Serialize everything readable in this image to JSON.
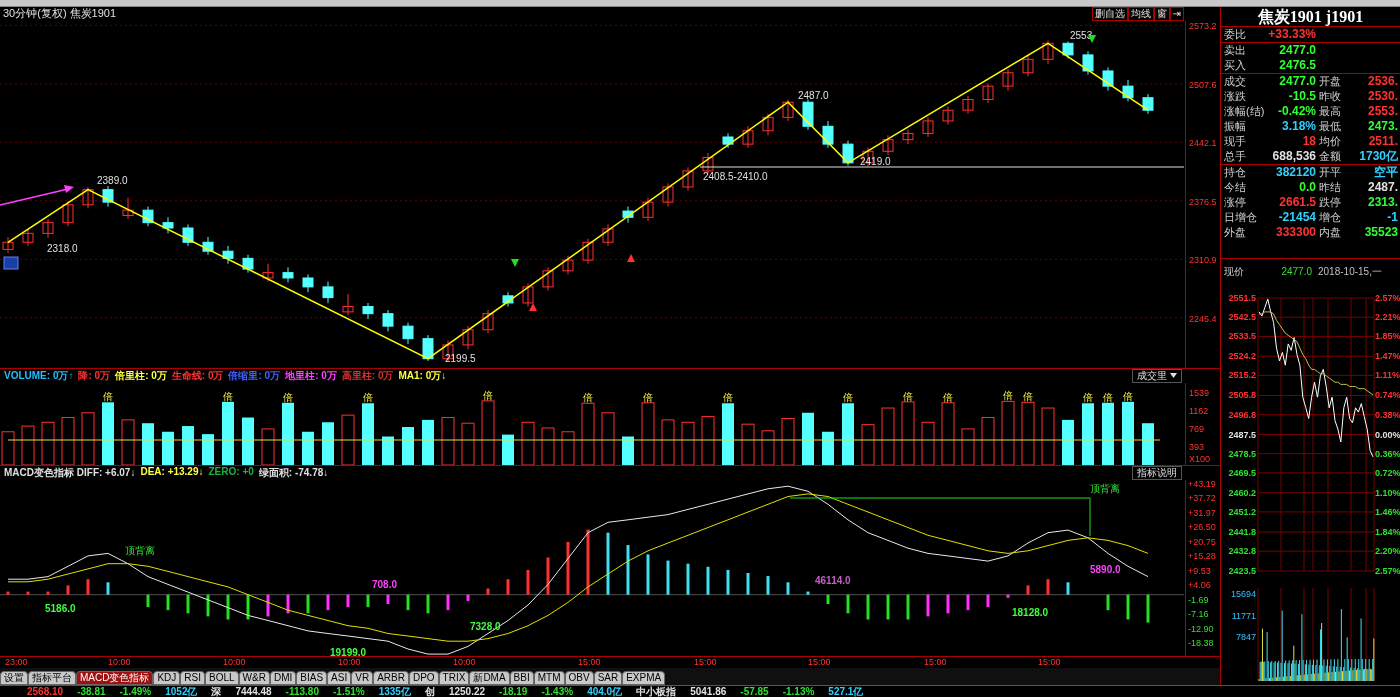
{
  "header": {
    "title": "30分钟(复权) 焦炭1901",
    "buttons": [
      "删自选",
      "均线",
      "窗",
      "⇥"
    ]
  },
  "main_chart": {
    "price_axis": [
      "2573.2",
      "2507.6",
      "2442.1",
      "2376.5",
      "2310.9",
      "2245.4"
    ],
    "chart_data": {
      "type": "candlestick",
      "grid": true,
      "ylim": [
        2189.1,
        2578
      ],
      "yticks": [
        2573.2,
        2507.6,
        2442.1,
        2376.5,
        2310.9,
        2245.4
      ],
      "ohlc": [
        [
          2322,
          2336,
          2318,
          2330
        ],
        [
          2330,
          2345,
          2326,
          2340
        ],
        [
          2340,
          2356,
          2335,
          2352
        ],
        [
          2352,
          2376,
          2348,
          2372
        ],
        [
          2372,
          2392,
          2368,
          2389
        ],
        [
          2389,
          2393,
          2370,
          2375
        ],
        [
          2360,
          2380,
          2356,
          2366
        ],
        [
          2366,
          2370,
          2348,
          2352
        ],
        [
          2352,
          2358,
          2340,
          2346
        ],
        [
          2346,
          2350,
          2326,
          2330
        ],
        [
          2330,
          2336,
          2316,
          2320
        ],
        [
          2320,
          2326,
          2306,
          2312
        ],
        [
          2312,
          2316,
          2296,
          2300
        ],
        [
          2290,
          2306,
          2286,
          2296
        ],
        [
          2296,
          2302,
          2285,
          2290
        ],
        [
          2290,
          2294,
          2274,
          2280
        ],
        [
          2280,
          2286,
          2262,
          2268
        ],
        [
          2252,
          2272,
          2248,
          2258
        ],
        [
          2258,
          2262,
          2244,
          2250
        ],
        [
          2250,
          2254,
          2230,
          2236
        ],
        [
          2236,
          2240,
          2216,
          2222
        ],
        [
          2222,
          2226,
          2197,
          2199.5
        ],
        [
          2199.5,
          2220,
          2196,
          2215
        ],
        [
          2215,
          2236,
          2210,
          2232
        ],
        [
          2232,
          2254,
          2228,
          2250
        ],
        [
          2270,
          2274,
          2258,
          2262
        ],
        [
          2262,
          2284,
          2258,
          2280
        ],
        [
          2280,
          2302,
          2276,
          2298
        ],
        [
          2298,
          2315,
          2294,
          2310
        ],
        [
          2310,
          2334,
          2306,
          2330
        ],
        [
          2330,
          2350,
          2326,
          2345
        ],
        [
          2365,
          2370,
          2352,
          2358
        ],
        [
          2358,
          2380,
          2354,
          2375
        ],
        [
          2375,
          2396,
          2370,
          2392
        ],
        [
          2392,
          2414,
          2388,
          2410
        ],
        [
          2410,
          2430,
          2406,
          2425
        ],
        [
          2448,
          2452,
          2436,
          2440
        ],
        [
          2440,
          2460,
          2436,
          2455
        ],
        [
          2455,
          2474,
          2450,
          2470
        ],
        [
          2470,
          2490,
          2466,
          2487
        ],
        [
          2487,
          2490,
          2456,
          2460
        ],
        [
          2460,
          2466,
          2436,
          2440
        ],
        [
          2440,
          2444,
          2416,
          2419
        ],
        [
          2419,
          2436,
          2415,
          2432
        ],
        [
          2432,
          2450,
          2428,
          2445
        ],
        [
          2445,
          2456,
          2440,
          2452
        ],
        [
          2452,
          2470,
          2448,
          2466
        ],
        [
          2466,
          2482,
          2462,
          2478
        ],
        [
          2478,
          2494,
          2474,
          2490
        ],
        [
          2490,
          2508,
          2486,
          2505
        ],
        [
          2505,
          2524,
          2500,
          2520
        ],
        [
          2520,
          2540,
          2516,
          2535
        ],
        [
          2535,
          2556,
          2530,
          2553
        ],
        [
          2553,
          2555,
          2536,
          2540
        ],
        [
          2540,
          2544,
          2518,
          2522
        ],
        [
          2522,
          2526,
          2500,
          2505
        ],
        [
          2505,
          2512,
          2488,
          2492
        ],
        [
          2492,
          2496,
          2474,
          2478
        ]
      ]
    },
    "pivots": [
      {
        "label": "2318.0"
      },
      {
        "label": "2389.0"
      },
      {
        "label": "2199.5"
      },
      {
        "label": "2487.0"
      },
      {
        "label": "2419.0"
      },
      {
        "label": "2553"
      }
    ],
    "support_label": "2408.5-2410.0"
  },
  "volume": {
    "legend": [
      {
        "text": "VOLUME: 0万↑",
        "color": "#20c0ff"
      },
      {
        "text": "降: 0万",
        "color": "#ff3030"
      },
      {
        "text": "倍里柱: 0万",
        "color": "#ffff40"
      },
      {
        "text": "生命线: 0万",
        "color": "#ff3030"
      },
      {
        "text": "倍缩里: 0万",
        "color": "#4060ff"
      },
      {
        "text": "地里柱: 0万",
        "color": "#ff40ff"
      },
      {
        "text": "高里柱: 0万",
        "color": "#d03030"
      },
      {
        "text": "MA1: 0万↓",
        "color": "#ffff40"
      }
    ],
    "menu": "成交里",
    "axis": [
      "1539",
      "1162",
      "769",
      "393"
    ],
    "unit": "X100",
    "chart_data": {
      "type": "bar",
      "ylim": [
        0,
        1727
      ],
      "yticks": [
        1539,
        1162,
        769,
        393
      ],
      "values": [
        700,
        820,
        900,
        1000,
        1100,
        1320,
        950,
        880,
        700,
        820,
        650,
        1330,
        1000,
        760,
        1310,
        700,
        900,
        1050,
        1300,
        600,
        800,
        950,
        1000,
        880,
        1350,
        640,
        900,
        780,
        700,
        1300,
        1100,
        600,
        1310,
        950,
        900,
        1020,
        1300,
        860,
        720,
        980,
        1100,
        700,
        1300,
        850,
        1200,
        1330,
        900,
        1310,
        760,
        1000,
        1340,
        1320,
        1200,
        950,
        1300,
        1310,
        1330,
        880
      ]
    },
    "marks": [
      "倍",
      "倍",
      "倍",
      "倍",
      "倍",
      "倍",
      "倍",
      "倍",
      "倍",
      "倍",
      "倍",
      "倍",
      "倍",
      "倍",
      "倍",
      "倍"
    ]
  },
  "macd": {
    "legend": [
      {
        "text": "MACD变色指标 DIFF: +6.07↓",
        "color": "#e0e0e0"
      },
      {
        "text": "DEA: +13.29↓",
        "color": "#ffff40"
      },
      {
        "text": "ZERO: +0",
        "color": "#20b040"
      },
      {
        "text": "绿面积: -74.78↓",
        "color": "#e0e0e0"
      }
    ],
    "help_button": "指标说明",
    "chart_data": {
      "type": "line",
      "ylim": [
        -24.5,
        44
      ],
      "yticks": [
        {
          "value": 43.19,
          "label": "+43.19"
        },
        {
          "value": 37.72,
          "label": "+37.72"
        },
        {
          "value": 31.97,
          "label": "+31.97"
        },
        {
          "value": 26.5,
          "label": "+26.50"
        },
        {
          "value": 20.75,
          "label": "+20.75"
        },
        {
          "value": 15.28,
          "label": "+15.28"
        },
        {
          "value": 9.53,
          "label": "+9.53"
        },
        {
          "value": 4.06,
          "label": "+4.06"
        },
        {
          "value": -1.69,
          "label": "-1.69"
        },
        {
          "value": -7.16,
          "label": "-7.16"
        },
        {
          "value": -12.9,
          "label": "-12.90"
        },
        {
          "value": -18.38,
          "label": "-18.38"
        }
      ],
      "series": [
        {
          "color": "#e8e8e8",
          "values": [
            6,
            6,
            7,
            11,
            15,
            16,
            12,
            7,
            4,
            1,
            -2,
            -5,
            -8,
            -10,
            -12,
            -14,
            -15,
            -16,
            -17,
            -18,
            -21,
            -23,
            -23,
            -20,
            -15,
            -10,
            -4,
            4,
            14,
            24,
            28,
            29,
            30,
            31,
            33,
            35,
            37,
            39,
            41,
            42,
            40,
            35,
            29,
            24,
            21,
            18,
            16,
            15,
            14,
            13,
            15,
            20,
            24,
            25,
            22,
            16,
            11,
            7
          ]
        },
        {
          "color": "#e0e000",
          "values": [
            5,
            5,
            6,
            8,
            10,
            12,
            12,
            11,
            9,
            7,
            5,
            3,
            0,
            -3,
            -6,
            -8,
            -10,
            -12,
            -13,
            -15,
            -16,
            -17,
            -18,
            -18,
            -17,
            -15,
            -12,
            -8,
            -3,
            3,
            8,
            13,
            17,
            20,
            23,
            26,
            29,
            32,
            35,
            38,
            39,
            38,
            35,
            32,
            29,
            26,
            23,
            21,
            19,
            17,
            16,
            17,
            19,
            21,
            22,
            21,
            19,
            16
          ]
        }
      ]
    },
    "annotations": [
      {
        "label": "顶背离"
      },
      {
        "label": "顶背离"
      }
    ],
    "area_labels": [
      {
        "label": "5186.0",
        "color": "#40ff40"
      },
      {
        "label": "19199.0",
        "color": "#40ff40"
      },
      {
        "label": "708.0",
        "color": "#ff40ff"
      },
      {
        "label": "7328.0",
        "color": "#40ff40"
      },
      {
        "label": "46114.0",
        "color": "#c060c0"
      },
      {
        "label": "18128.0",
        "color": "#40ff40"
      },
      {
        "label": "5890.0",
        "color": "#ff40ff"
      }
    ]
  },
  "time_axis": [
    "23:00",
    "10:00",
    "10:00",
    "10:00",
    "10:00",
    "15:00",
    "15:00",
    "15:00",
    "15:00",
    "15:00"
  ],
  "tabs": [
    {
      "label": "设置",
      "selected": false
    },
    {
      "label": "指标平台",
      "selected": false
    },
    {
      "label": "MACD变色指标",
      "selected": true
    },
    {
      "label": "KDJ",
      "selected": false
    },
    {
      "label": "RSI",
      "selected": false
    },
    {
      "label": "BOLL",
      "selected": false
    },
    {
      "label": "W&R",
      "selected": false
    },
    {
      "label": "DMI",
      "selected": false
    },
    {
      "label": "BIAS",
      "selected": false
    },
    {
      "label": "ASI",
      "selected": false
    },
    {
      "label": "VR",
      "selected": false
    },
    {
      "label": "ARBR",
      "selected": false
    },
    {
      "label": "DPO",
      "selected": false
    },
    {
      "label": "TRIX",
      "selected": false
    },
    {
      "label": "新DMA",
      "selected": false
    },
    {
      "label": "BBI",
      "selected": false
    },
    {
      "label": "MTM",
      "selected": false
    },
    {
      "label": "OBV",
      "selected": false
    },
    {
      "label": "SAR",
      "selected": false
    },
    {
      "label": "EXPMA",
      "selected": false
    }
  ],
  "quote": {
    "title": "焦炭1901 j1901",
    "sections": [
      [
        {
          "label": "委比",
          "value": "+33.33%",
          "color": "#ff3232"
        }
      ],
      [
        {
          "label": "卖出",
          "value": "2477.0",
          "color": "#30ff30"
        },
        {
          "label": "买入",
          "value": "2476.5",
          "color": "#30ff30"
        }
      ],
      [
        {
          "label": "成交",
          "value": "2477.0",
          "color": "#30ff30",
          "right": {
            "label": "开盘",
            "value": "2536.",
            "color": "#ff3232"
          }
        },
        {
          "label": "涨跌",
          "value": "-10.5",
          "color": "#30ff30",
          "right": {
            "label": "昨收",
            "value": "2530.",
            "color": "#ff3232"
          }
        },
        {
          "label": "涨幅(结)",
          "value": "-0.42%",
          "color": "#30ff30",
          "right": {
            "label": "最高",
            "value": "2553.",
            "color": "#ff3232"
          }
        },
        {
          "label": "振幅",
          "value": "3.18%",
          "color": "#30d0ff",
          "right": {
            "label": "最低",
            "value": "2473.",
            "color": "#30ff30"
          }
        },
        {
          "label": "现手",
          "value": "18",
          "color": "#ff3232",
          "right": {
            "label": "均价",
            "value": "2511.",
            "color": "#ff3232"
          }
        },
        {
          "label": "总手",
          "value": "688,536",
          "color": "#e0e0e0",
          "right": {
            "label": "金额",
            "value": "1730亿",
            "color": "#30d0ff"
          }
        }
      ],
      [
        {
          "label": "持仓",
          "value": "382120",
          "color": "#30d0ff",
          "right": {
            "label": "开平",
            "value": "空平",
            "color": "#30d0ff"
          }
        },
        {
          "label": "今结",
          "value": "0.0",
          "color": "#30ff30",
          "right": {
            "label": "昨结",
            "value": "2487.",
            "color": "#e0e0e0"
          }
        },
        {
          "label": "涨停",
          "value": "2661.5",
          "color": "#ff3232",
          "right": {
            "label": "跌停",
            "value": "2313.",
            "color": "#30ff30"
          }
        },
        {
          "label": "日增仓",
          "value": "-21454",
          "color": "#30d0ff",
          "right": {
            "label": "增仓",
            "value": "-1",
            "color": "#30d0ff"
          }
        },
        {
          "label": "外盘",
          "value": "333300",
          "color": "#ff3232",
          "right": {
            "label": "内盘",
            "value": "35523",
            "color": "#30ff30"
          }
        }
      ]
    ],
    "price_label": "现价",
    "price": "2477.0",
    "datetime": "2018-10-15,一"
  },
  "intraday": {
    "price_axis": [
      {
        "label": "2551.5",
        "color": "#ff3232"
      },
      {
        "label": "2542.5",
        "color": "#ff3232"
      },
      {
        "label": "2533.5",
        "color": "#ff3232"
      },
      {
        "label": "2524.2",
        "color": "#ff3232"
      },
      {
        "label": "2515.2",
        "color": "#ff3232"
      },
      {
        "label": "2505.8",
        "color": "#ff3232"
      },
      {
        "label": "2496.8",
        "color": "#ff3232"
      },
      {
        "label": "2487.5",
        "color": "#e0e0e0"
      },
      {
        "label": "2478.5",
        "color": "#30e030"
      },
      {
        "label": "2469.5",
        "color": "#30e030"
      },
      {
        "label": "2460.2",
        "color": "#30e030"
      },
      {
        "label": "2451.2",
        "color": "#30e030"
      },
      {
        "label": "2441.8",
        "color": "#30e030"
      },
      {
        "label": "2432.8",
        "color": "#30e030"
      },
      {
        "label": "2423.5",
        "color": "#30e030"
      }
    ],
    "pct_axis": [
      {
        "label": "2.57%",
        "color": "#ff3232"
      },
      {
        "label": "2.21%",
        "color": "#ff3232"
      },
      {
        "label": "1.85%",
        "color": "#ff3232"
      },
      {
        "label": "1.47%",
        "color": "#ff3232"
      },
      {
        "label": "1.11%",
        "color": "#ff3232"
      },
      {
        "label": "0.74%",
        "color": "#ff3232"
      },
      {
        "label": "0.38%",
        "color": "#ff3232"
      },
      {
        "label": "0.00%",
        "color": "#e0e0e0"
      },
      {
        "label": "0.36%",
        "color": "#30e030"
      },
      {
        "label": "0.72%",
        "color": "#30e030"
      },
      {
        "label": "1.10%",
        "color": "#30e030"
      },
      {
        "label": "1.46%",
        "color": "#30e030"
      },
      {
        "label": "1.84%",
        "color": "#30e030"
      },
      {
        "label": "2.20%",
        "color": "#30e030"
      },
      {
        "label": "2.57%",
        "color": "#30e030"
      }
    ],
    "chart_data": {
      "type": "line",
      "grid": true,
      "ylim": [
        2423.5,
        2551.5
      ],
      "yticks": [
        2551.5,
        2542.5,
        2533.5,
        2524.2,
        2515.2,
        2505.8,
        2496.8,
        2487.5,
        2478.5,
        2469.5,
        2460.2,
        2451.2,
        2441.8,
        2432.8,
        2423.5
      ],
      "series": [
        {
          "color": "#ffffff",
          "values": [
            2545,
            2543,
            2547,
            2551,
            2545,
            2540,
            2528,
            2522,
            2526,
            2520,
            2530,
            2527,
            2533,
            2525,
            2520,
            2505,
            2500,
            2495,
            2505,
            2512,
            2505,
            2515,
            2518,
            2510,
            2500,
            2505,
            2494,
            2490,
            2484,
            2500,
            2505,
            2495,
            2493,
            2500,
            2498,
            2502,
            2496,
            2490,
            2480,
            2477
          ]
        },
        {
          "color": "#c0c050",
          "values": [
            2544,
            2544,
            2545,
            2545,
            2545,
            2544,
            2541,
            2539,
            2537,
            2535,
            2534,
            2533,
            2532,
            2531,
            2528,
            2525,
            2523,
            2520,
            2518,
            2518,
            2517,
            2516,
            2516,
            2515,
            2514,
            2513,
            2512,
            2512,
            2511,
            2511,
            2511,
            2510,
            2510,
            2510,
            2509,
            2509,
            2509,
            2508,
            2507,
            2506
          ]
        }
      ]
    },
    "volume_axis": [
      "15694",
      "11771",
      "7847"
    ]
  },
  "status_bar": [
    {
      "text": "2568.10",
      "color": "#ff3232"
    },
    {
      "text": "-38.81",
      "color": "#30e030"
    },
    {
      "text": "-1.49%",
      "color": "#30e030"
    },
    {
      "text": "1052亿",
      "color": "#30d0ff"
    },
    {
      "text": "深",
      "color": "#e0e0e0"
    },
    {
      "text": "7444.48",
      "color": "#e0e0e0"
    },
    {
      "text": "-113.80",
      "color": "#30e030"
    },
    {
      "text": "-1.51%",
      "color": "#30e030"
    },
    {
      "text": "1335亿",
      "color": "#30d0ff"
    },
    {
      "text": "创",
      "color": "#e0e0e0"
    },
    {
      "text": "1250.22",
      "color": "#e0e0e0"
    },
    {
      "text": "-18.19",
      "color": "#30e030"
    },
    {
      "text": "-1.43%",
      "color": "#30e030"
    },
    {
      "text": "404.0亿",
      "color": "#30d0ff"
    },
    {
      "text": "中小板指",
      "color": "#e0e0e0"
    },
    {
      "text": "5041.86",
      "color": "#e0e0e0"
    },
    {
      "text": "-57.85",
      "color": "#30e030"
    },
    {
      "text": "-1.13%",
      "color": "#30e030"
    },
    {
      "text": "527.1亿",
      "color": "#30d0ff"
    }
  ]
}
